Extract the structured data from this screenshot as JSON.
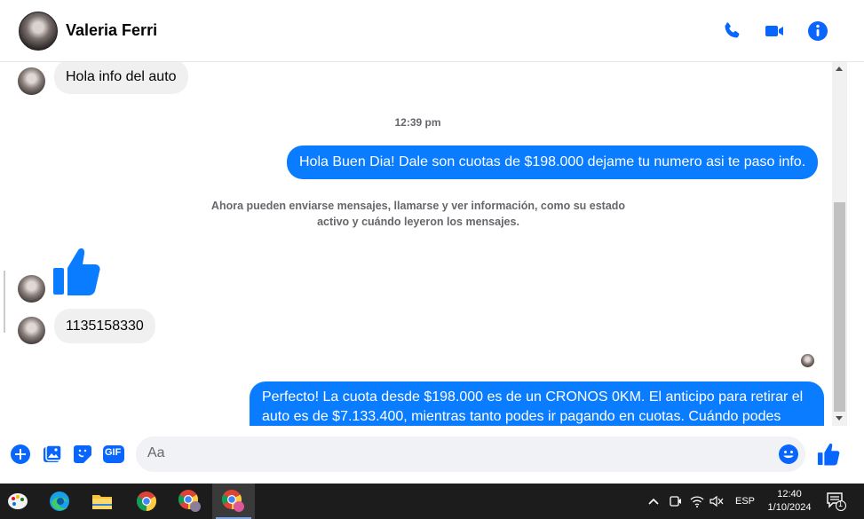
{
  "contact": {
    "name": "Valeria Ferri"
  },
  "messages": {
    "m1": "Hola info del auto",
    "time": "12:39 pm",
    "m2": "Hola Buen Dia! Dale son cuotas de $198.000 dejame tu numero asi te paso info.",
    "system_line1": "Ahora pueden enviarse mensajes, llamarse y ver información, como su estado",
    "system_line2": "activo y cuándo leyeron los mensajes.",
    "m3": "1135158330",
    "m4_line1": "Perfecto! La cuota desde $198.000 es de un CRONOS 0KM. El anticipo para retirar el",
    "m4_line2": "auto es de $7.133.400, mientras tanto podes ir pagando en cuotas. Cuándo podes"
  },
  "composer": {
    "placeholder": "Aa",
    "gif_label": "GIF"
  },
  "taskbar": {
    "apps": [
      "paint-icon",
      "edge-icon",
      "file-explorer-icon",
      "chrome-icon",
      "chrome-profile-icon",
      "chrome-profile-c-icon"
    ],
    "language": "ESP",
    "time": "12:40",
    "date": "1/10/2024",
    "notification_count": "1"
  },
  "colors": {
    "accent": "#0a7cff",
    "icon_blue": "#0866ff",
    "incoming_bubble": "#f0f0f0"
  }
}
